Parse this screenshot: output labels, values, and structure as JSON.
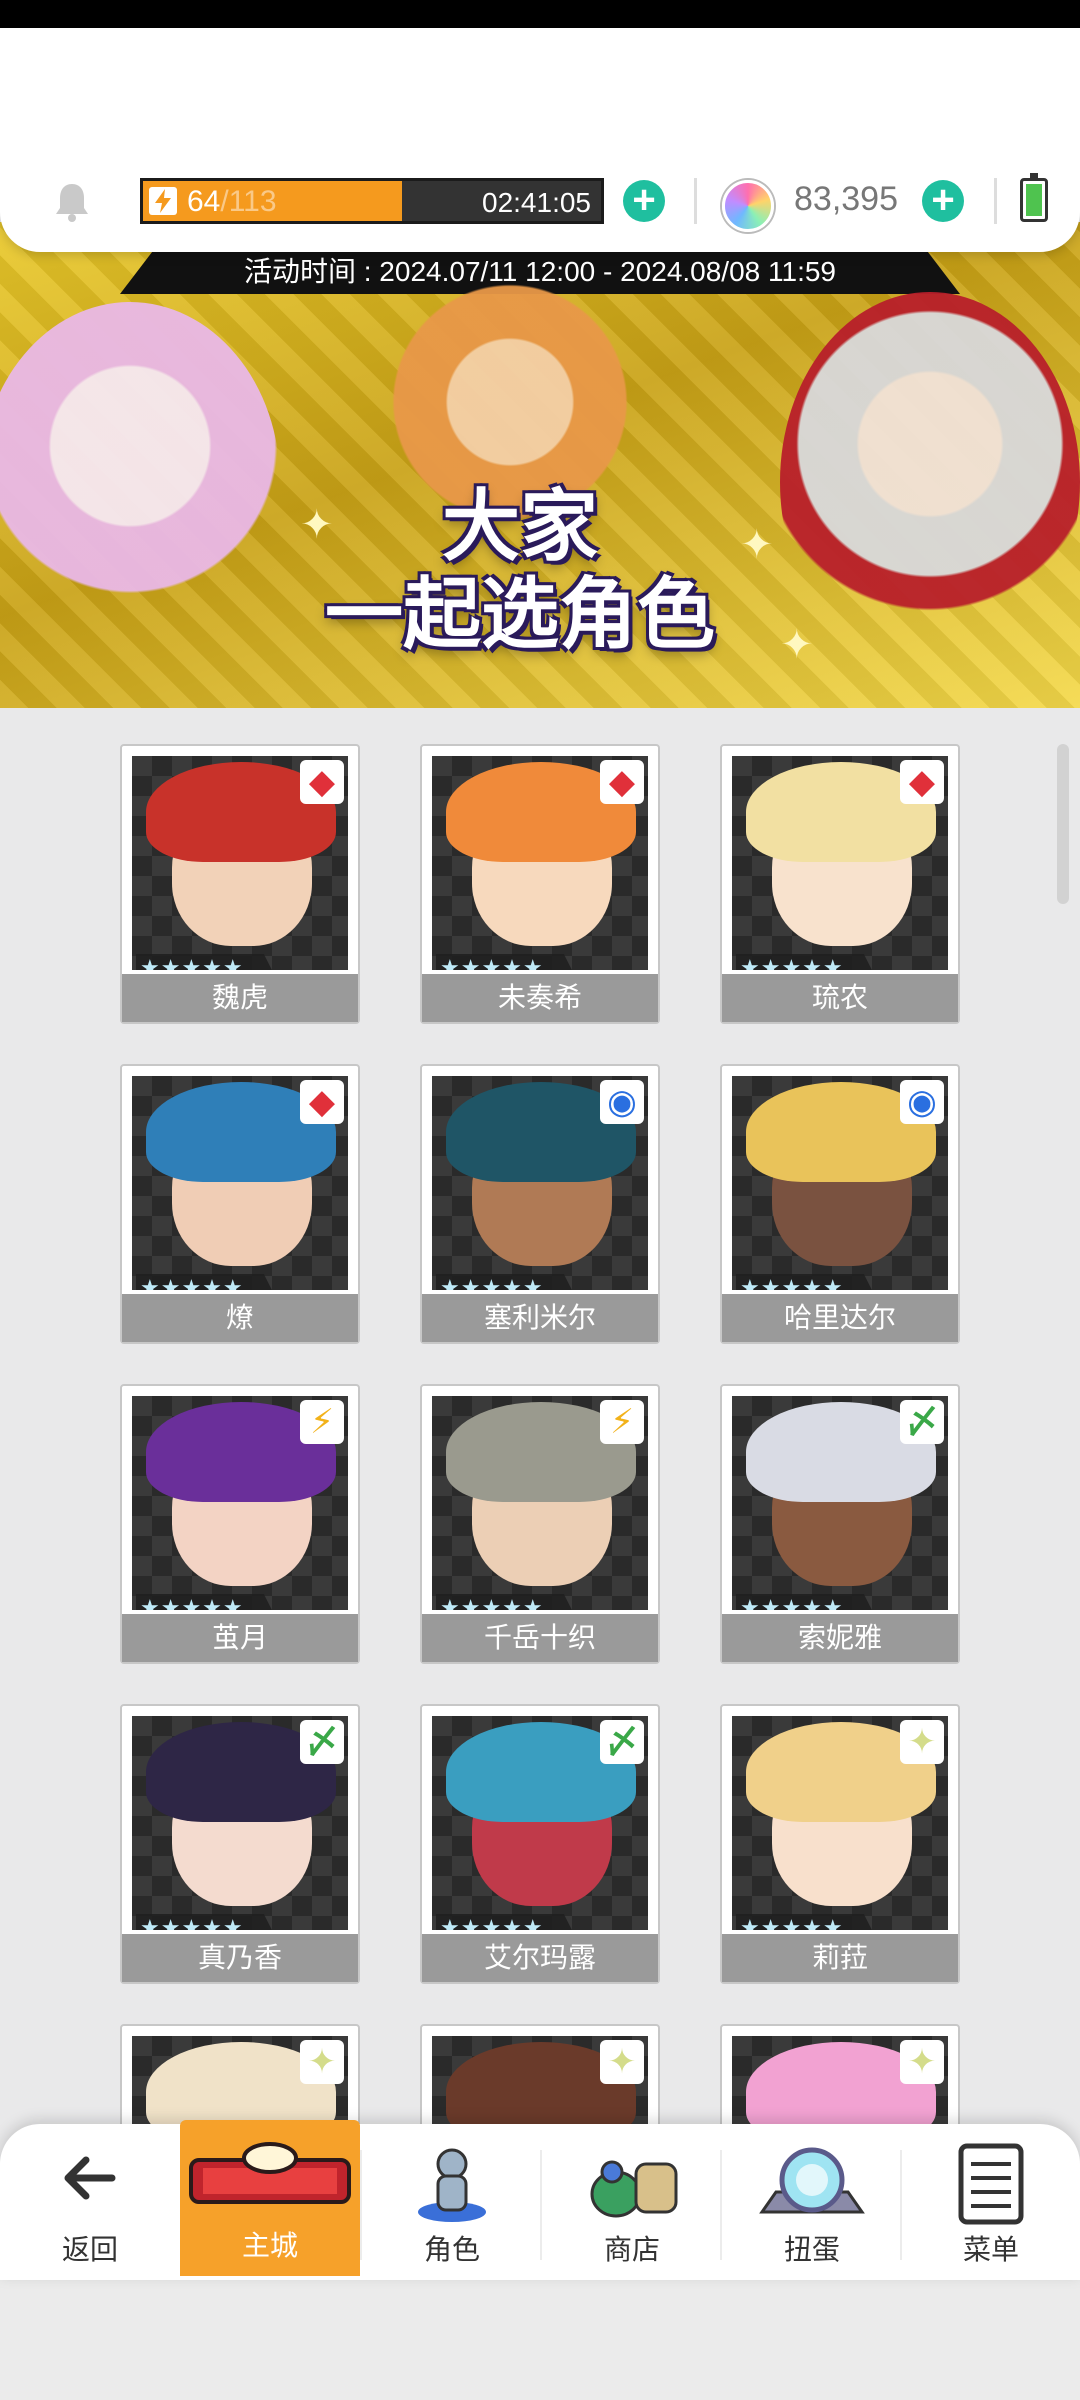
{
  "header": {
    "stamina_current": "64",
    "stamina_max": "/113",
    "stamina_fraction": 0.566,
    "timer": "02:41:05",
    "gem_count": "83,395"
  },
  "banner": {
    "event_time": "活动时间 : 2024.07/11 12:00 - 2024.08/08 11:59",
    "title_line1": "大家",
    "title_line2": "一起选角色"
  },
  "characters": [
    {
      "name": "魏虎",
      "stars": "★★★★★",
      "element": "diamond",
      "element_glyph": "◆",
      "element_color": "#e0303a",
      "hair": "#c8322a",
      "skin": "#f2d2b8"
    },
    {
      "name": "未奏希",
      "stars": "★★★★★",
      "element": "diamond",
      "element_glyph": "◆",
      "element_color": "#e0303a",
      "hair": "#f08a3a",
      "skin": "#f7d9bd"
    },
    {
      "name": "琉农",
      "stars": "★★★★★",
      "element": "diamond",
      "element_glyph": "◆",
      "element_color": "#e0303a",
      "hair": "#f2e0a2",
      "skin": "#f8e2cd"
    },
    {
      "name": "燎",
      "stars": "★★★★★",
      "element": "diamond",
      "element_glyph": "◆",
      "element_color": "#e0303a",
      "hair": "#2f7fb8",
      "skin": "#f0cdb5"
    },
    {
      "name": "塞利米尔",
      "stars": "★★★★★",
      "element": "water",
      "element_glyph": "◉",
      "element_color": "#2a6fe0",
      "hair": "#1f5566",
      "skin": "#b07a55"
    },
    {
      "name": "哈里达尔",
      "stars": "★★★★★",
      "element": "water",
      "element_glyph": "◉",
      "element_color": "#2a6fe0",
      "hair": "#e9c35a",
      "skin": "#7a5240"
    },
    {
      "name": "茧月",
      "stars": "★★★★★",
      "element": "lightning",
      "element_glyph": "⚡",
      "element_color": "#f2b21a",
      "hair": "#6a2f9a",
      "skin": "#f3d3c4"
    },
    {
      "name": "千岳十织",
      "stars": "★★★★★",
      "element": "lightning",
      "element_glyph": "⚡",
      "element_color": "#f2b21a",
      "hair": "#9a9a8e",
      "skin": "#eccfb5"
    },
    {
      "name": "索妮雅",
      "stars": "★★★★★",
      "element": "wind",
      "element_glyph": "〆",
      "element_color": "#3aa848",
      "hair": "#d9dbe4",
      "skin": "#8a5a40"
    },
    {
      "name": "真乃香",
      "stars": "★★★★★",
      "element": "wind",
      "element_glyph": "〆",
      "element_color": "#3aa848",
      "hair": "#2e2646",
      "skin": "#f4dbcf"
    },
    {
      "name": "艾尔玛露",
      "stars": "★★★★★",
      "element": "wind",
      "element_glyph": "〆",
      "element_color": "#3aa848",
      "hair": "#3a9ec0",
      "skin": "#c03a4a"
    },
    {
      "name": "莉菈",
      "stars": "★★★★★",
      "element": "light",
      "element_glyph": "✦",
      "element_color": "#d4dc8a",
      "hair": "#f0d08a",
      "skin": "#f8e0cc"
    },
    {
      "name": "",
      "stars": "",
      "element": "light",
      "element_glyph": "✦",
      "element_color": "#d4dc8a",
      "hair": "#f0e2c8",
      "skin": "#f8e4d4"
    },
    {
      "name": "",
      "stars": "",
      "element": "light",
      "element_glyph": "✦",
      "element_color": "#d4dc8a",
      "hair": "#6a3a2a",
      "skin": "#f3d6c2"
    },
    {
      "name": "",
      "stars": "",
      "element": "light",
      "element_glyph": "✦",
      "element_color": "#d4dc8a",
      "hair": "#f2a2d2",
      "skin": "#f8dde6"
    }
  ],
  "nav": {
    "back": "返回",
    "castle": "主城",
    "characters": "角色",
    "shop": "商店",
    "gacha": "扭蛋",
    "menu": "菜单"
  },
  "colors": {
    "accent_orange": "#f6a12a",
    "plus_green": "#1fbf9f",
    "stamina_orange": "#f59a1e"
  }
}
